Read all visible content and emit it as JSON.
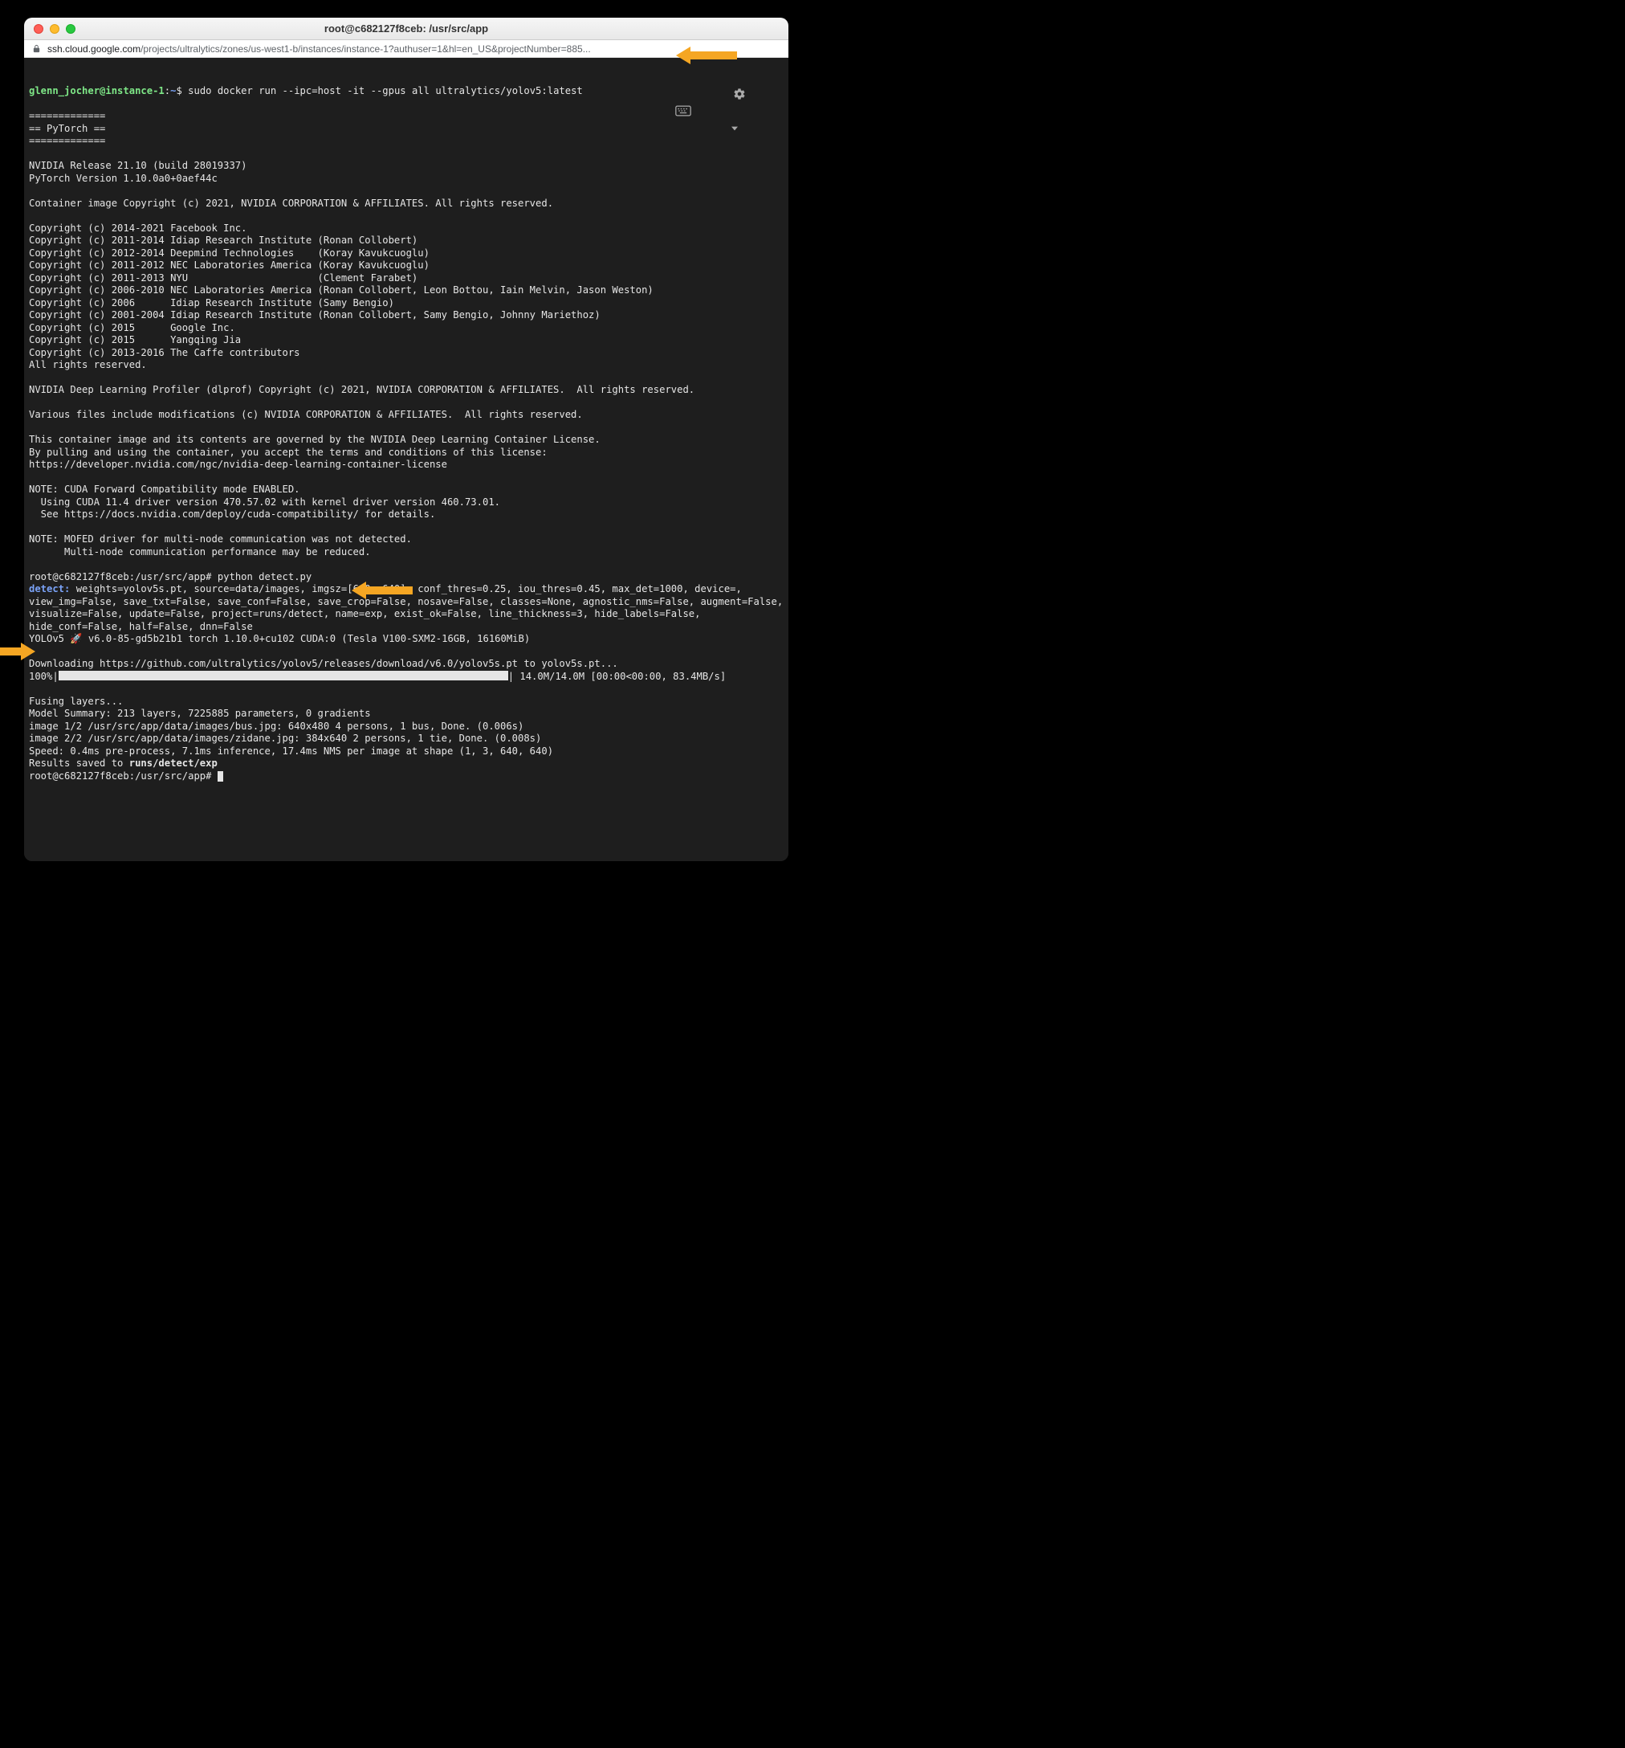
{
  "window": {
    "title": "root@c682127f8ceb: /usr/src/app"
  },
  "url": {
    "host": "ssh.cloud.google.com",
    "path": "/projects/ultralytics/zones/us-west1-b/instances/instance-1?authuser=1&hl=en_US&projectNumber=885..."
  },
  "prompt1": {
    "user_host": "glenn_jocher@instance-1",
    "sep": ":",
    "path": "~",
    "sigil": "$ ",
    "cmd": "sudo docker run --ipc=host -it --gpus all ultralytics/yolov5:latest"
  },
  "block": {
    "sep": "=============",
    "pytorch": "== PyTorch =="
  },
  "nvidia": {
    "release": "NVIDIA Release 21.10 (build 28019337)",
    "ptver": "PyTorch Version 1.10.0a0+0aef44c",
    "container": "Container image Copyright (c) 2021, NVIDIA CORPORATION & AFFILIATES. All rights reserved."
  },
  "copyrights": [
    "Copyright (c) 2014-2021 Facebook Inc.",
    "Copyright (c) 2011-2014 Idiap Research Institute (Ronan Collobert)",
    "Copyright (c) 2012-2014 Deepmind Technologies    (Koray Kavukcuoglu)",
    "Copyright (c) 2011-2012 NEC Laboratories America (Koray Kavukcuoglu)",
    "Copyright (c) 2011-2013 NYU                      (Clement Farabet)",
    "Copyright (c) 2006-2010 NEC Laboratories America (Ronan Collobert, Leon Bottou, Iain Melvin, Jason Weston)",
    "Copyright (c) 2006      Idiap Research Institute (Samy Bengio)",
    "Copyright (c) 2001-2004 Idiap Research Institute (Ronan Collobert, Samy Bengio, Johnny Mariethoz)",
    "Copyright (c) 2015      Google Inc.",
    "Copyright (c) 2015      Yangqing Jia",
    "Copyright (c) 2013-2016 The Caffe contributors",
    "All rights reserved."
  ],
  "dlprof": "NVIDIA Deep Learning Profiler (dlprof) Copyright (c) 2021, NVIDIA CORPORATION & AFFILIATES.  All rights reserved.",
  "mods": "Various files include modifications (c) NVIDIA CORPORATION & AFFILIATES.  All rights reserved.",
  "license": [
    "This container image and its contents are governed by the NVIDIA Deep Learning Container License.",
    "By pulling and using the container, you accept the terms and conditions of this license:",
    "https://developer.nvidia.com/ngc/nvidia-deep-learning-container-license"
  ],
  "note1": [
    "NOTE: CUDA Forward Compatibility mode ENABLED.",
    "  Using CUDA 11.4 driver version 470.57.02 with kernel driver version 460.73.01.",
    "  See https://docs.nvidia.com/deploy/cuda-compatibility/ for details."
  ],
  "note2": [
    "NOTE: MOFED driver for multi-node communication was not detected.",
    "      Multi-node communication performance may be reduced."
  ],
  "prompt2": {
    "full": "root@c682127f8ceb:/usr/src/app# ",
    "cmd": "python detect.py"
  },
  "detect_label": "detect: ",
  "detect_args": "weights=yolov5s.pt, source=data/images, imgsz=[640, 640], conf_thres=0.25, iou_thres=0.45, max_det=1000, device=, view_img=False, save_txt=False, save_conf=False, save_crop=False, nosave=False, classes=None, agnostic_nms=False, augment=False, visualize=False, update=False, project=runs/detect, name=exp, exist_ok=False, line_thickness=3, hide_labels=False, hide_conf=False, half=False, dnn=False",
  "yolo_line": "YOLOv5 🚀 v6.0-85-gd5b21b1 torch 1.10.0+cu102 CUDA:0 (Tesla V100-SXM2-16GB, 16160MiB)",
  "download": "Downloading https://github.com/ultralytics/yolov5/releases/download/v6.0/yolov5s.pt to yolov5s.pt...",
  "progress": {
    "pct": "100%",
    "stats": " 14.0M/14.0M [00:00<00:00, 83.4MB/s]"
  },
  "fusing": "Fusing layers...",
  "summary": "Model Summary: 213 layers, 7225885 parameters, 0 gradients",
  "img1": "image 1/2 /usr/src/app/data/images/bus.jpg: 640x480 4 persons, 1 bus, Done. (0.006s)",
  "img2": "image 2/2 /usr/src/app/data/images/zidane.jpg: 384x640 2 persons, 1 tie, Done. (0.008s)",
  "speed": "Speed: 0.4ms pre-process, 7.1ms inference, 17.4ms NMS per image at shape (1, 3, 640, 640)",
  "results_pre": "Results saved to ",
  "results_path": "runs/detect/exp",
  "prompt3": "root@c682127f8ceb:/usr/src/app# "
}
